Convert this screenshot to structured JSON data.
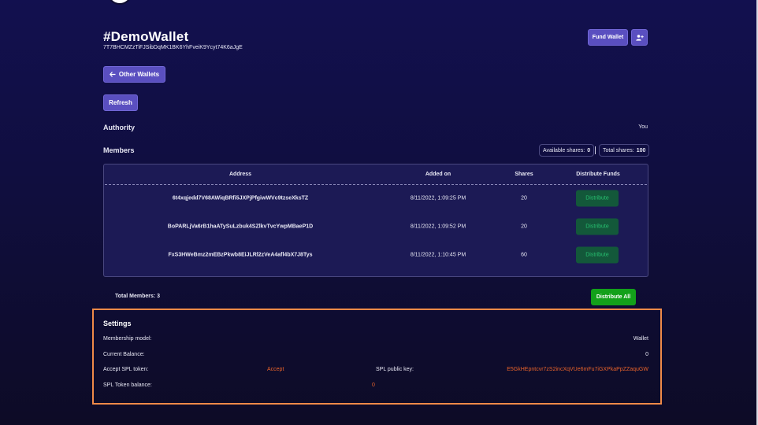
{
  "wallet": {
    "title": "#DemoWallet",
    "address": "7T7BHCMZzTiFJSibDqMK1BK6YhFveiK9Ycyt74K6aJgE"
  },
  "toolbar": {
    "fund_label": "Fund Wallet",
    "add_member_icon": "user-plus-icon",
    "back_icon": "arrow-left-icon",
    "other_wallets_label": "Other Wallets",
    "refresh_label": "Refresh"
  },
  "authority": {
    "label": "Authority",
    "value": "You"
  },
  "members": {
    "label": "Members",
    "available_label": "Available shares:",
    "available_value": "0",
    "total_label": "Total shares:",
    "total_value": "100",
    "columns": [
      "Address",
      "Added on",
      "Shares",
      "Distribute Funds"
    ],
    "rows": [
      {
        "address": "6t4xqjedd7V68AWiqBRfi5JXPjPfgiwWVc9tzseXksTZ",
        "added": "8/11/2022, 1:09:25 PM",
        "shares": "20",
        "action": "Distribute"
      },
      {
        "address": "BoPARLjVa6rB1haATySuLzbuk4SZlkvTvcYwpMBaeP1D",
        "added": "8/11/2022, 1:09:52 PM",
        "shares": "20",
        "action": "Distribute"
      },
      {
        "address": "FxS3HWeBmz2mEBzPkwb8EiJLRl2zVeA4afl4bX7J8Tys",
        "added": "8/11/2022, 1:10:45 PM",
        "shares": "60",
        "action": "Distribute"
      }
    ],
    "total_members": "Total Members: 3",
    "distribute_all_label": "Distribute All"
  },
  "settings": {
    "title": "Settings",
    "membership_model_label": "Membership model:",
    "membership_model_value": "Wallet",
    "current_balance_label": "Current Balance:",
    "current_balance_value": "0",
    "accept_spl_label": "Accept SPL token:",
    "accept_spl_value": "Accept",
    "spl_public_key_label": "SPL public key:",
    "spl_public_key_value": "E5GkHEpntcvr7zS2incXqVUe6mFu7iGXPkaPpZZaquGW",
    "spl_balance_label": "SPL Token balance:",
    "spl_balance_value": "0"
  },
  "colors": {
    "accent": "#5a4fc0",
    "success": "#13a01a",
    "highlight_border": "#ef8a48",
    "link_orange": "#e8632a"
  }
}
